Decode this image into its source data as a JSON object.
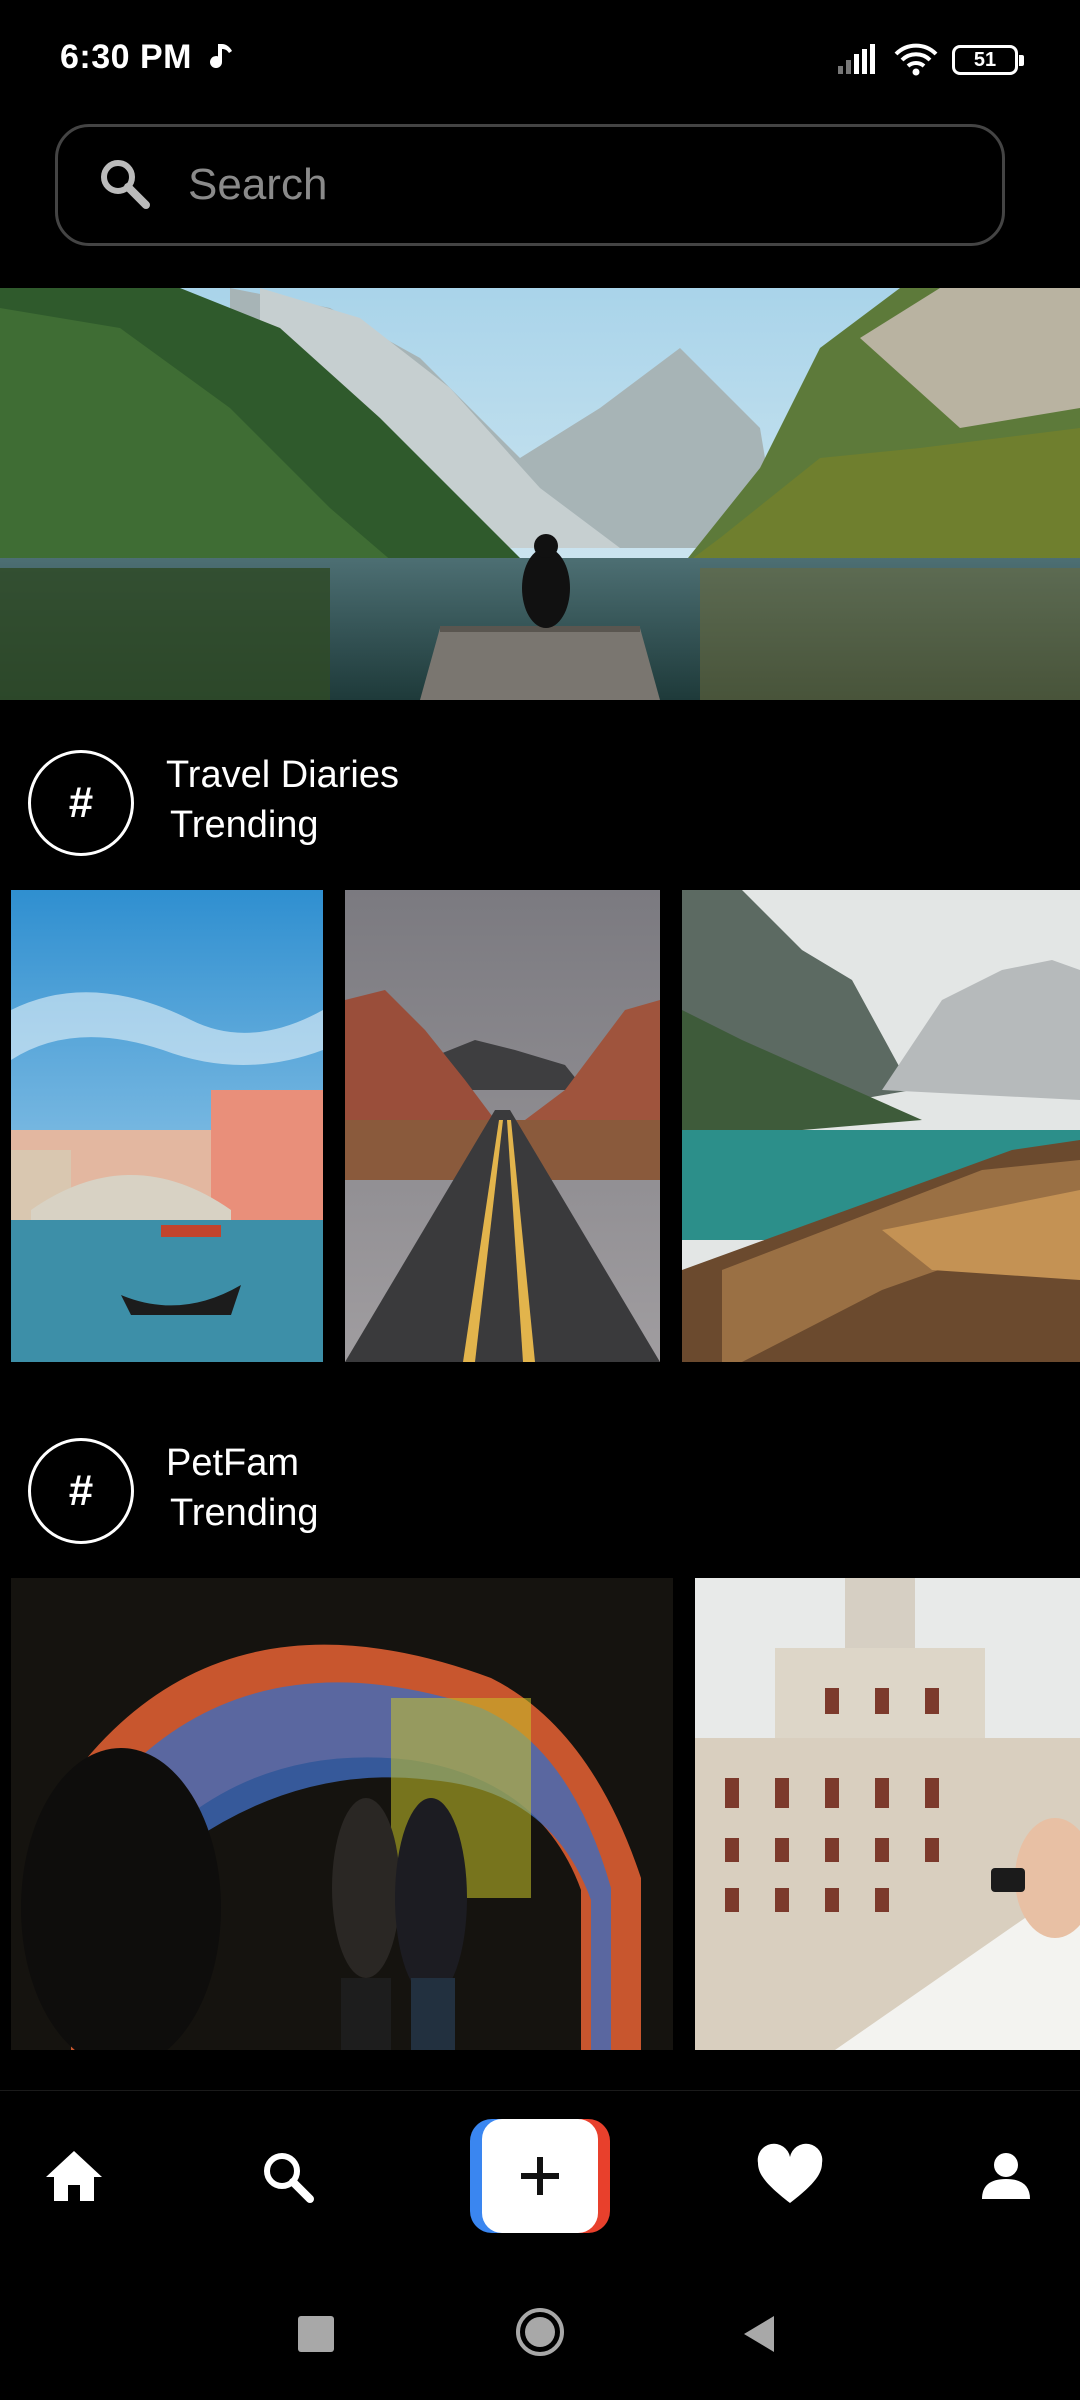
{
  "status_bar": {
    "time": "6:30 PM",
    "battery": "51",
    "icons": [
      "music-note-icon",
      "signal-icon",
      "wifi-icon",
      "battery-icon"
    ]
  },
  "search": {
    "placeholder": "Search",
    "icon": "search-icon"
  },
  "hashtags": [
    {
      "name": "Travel Diaries",
      "subtitle": "Trending",
      "symbol": "#"
    },
    {
      "name": "PetFam",
      "subtitle": "Trending",
      "symbol": "#"
    }
  ],
  "bottom_nav": {
    "items": [
      "home-icon",
      "search-icon",
      "add-post-icon",
      "heart-icon",
      "profile-icon"
    ],
    "add_symbol": "+"
  },
  "system_nav": {
    "items": [
      "recents-icon",
      "home-circle-icon",
      "back-icon"
    ]
  },
  "colors": {
    "background": "#000000",
    "add_blue": "#3a86f0",
    "add_red": "#e8402c"
  }
}
